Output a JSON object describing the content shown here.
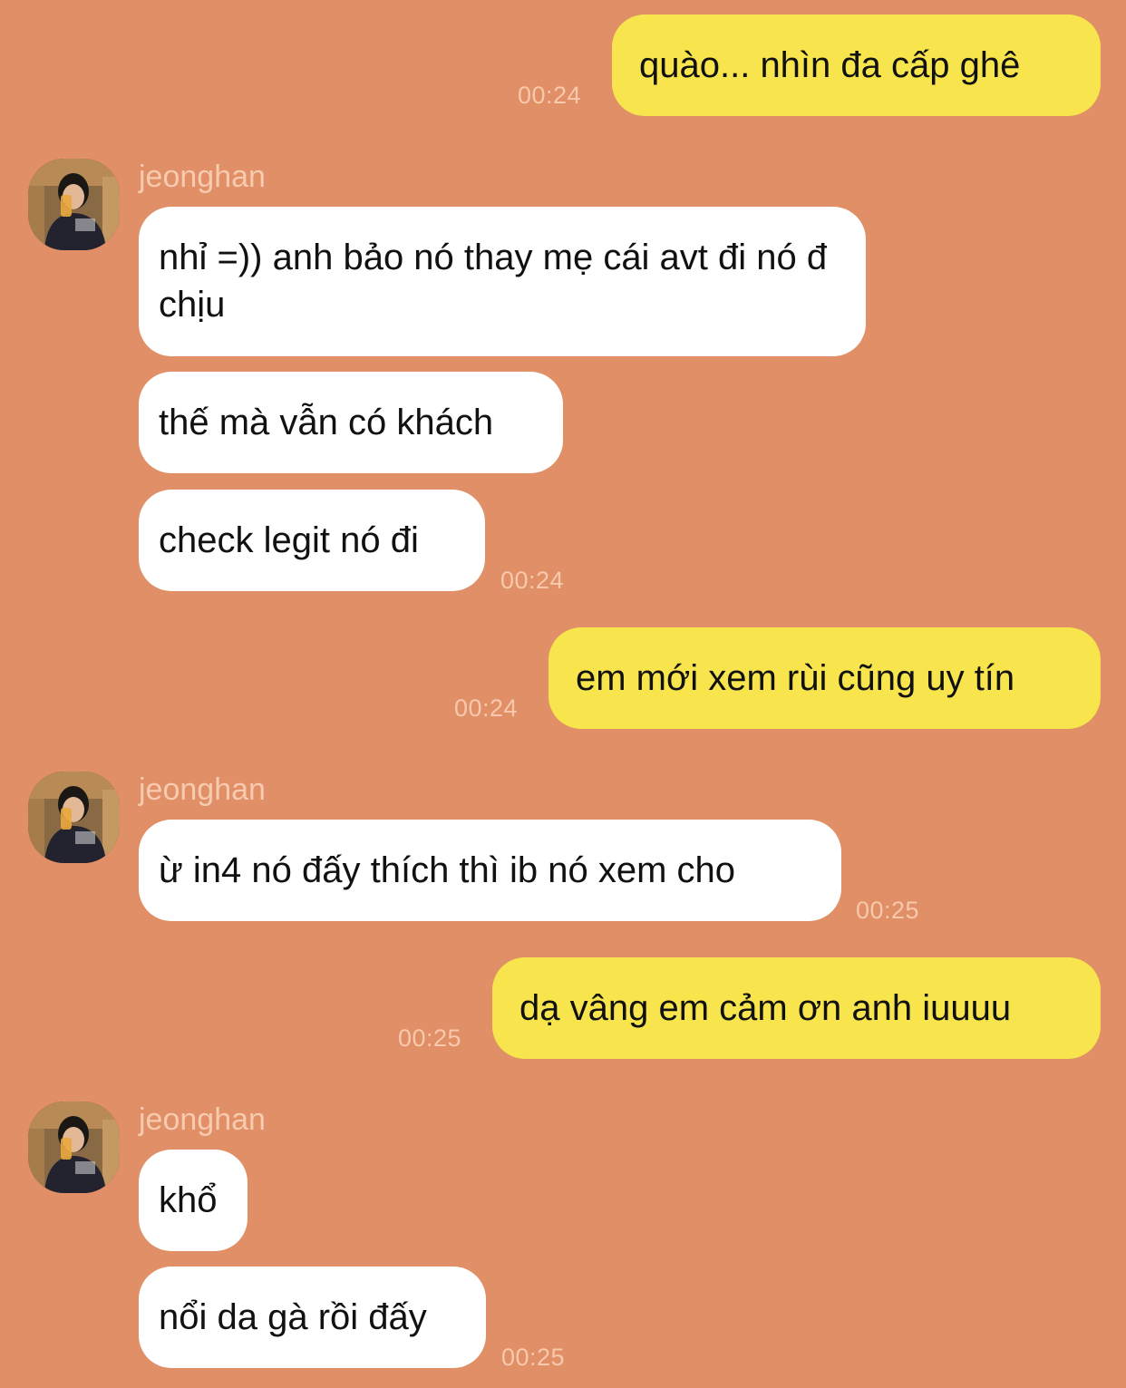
{
  "contact": {
    "name": "jeonghan",
    "avatar_icon": "profile-photo-avatar"
  },
  "colors": {
    "background": "#e08f66",
    "incoming_bubble": "#ffffff",
    "outgoing_bubble": "#f8e54d",
    "timestamp": "#f8c9ad"
  },
  "messages": [
    {
      "id": "m1",
      "direction": "out",
      "text": "quào... nhìn đa cấp ghê",
      "time": "00:24"
    },
    {
      "id": "m2",
      "direction": "in",
      "sender": "jeonghan",
      "text": "nhỉ =)) anh bảo nó thay mẹ cái avt đi nó đ chịu"
    },
    {
      "id": "m3",
      "direction": "in",
      "text": "thế mà vẫn có khách"
    },
    {
      "id": "m4",
      "direction": "in",
      "text": "check legit nó đi",
      "time": "00:24"
    },
    {
      "id": "m5",
      "direction": "out",
      "text": "em mới xem rùi cũng uy tín",
      "time": "00:24"
    },
    {
      "id": "m6",
      "direction": "in",
      "sender": "jeonghan",
      "text": "ừ in4 nó đấy thích thì ib nó xem cho",
      "time": "00:25"
    },
    {
      "id": "m7",
      "direction": "out",
      "text": "dạ vâng em cảm ơn anh iuuuu",
      "time": "00:25"
    },
    {
      "id": "m8",
      "direction": "in",
      "sender": "jeonghan",
      "text": "khổ"
    },
    {
      "id": "m9",
      "direction": "in",
      "text": "nổi da gà rồi đấy",
      "time": "00:25"
    }
  ]
}
